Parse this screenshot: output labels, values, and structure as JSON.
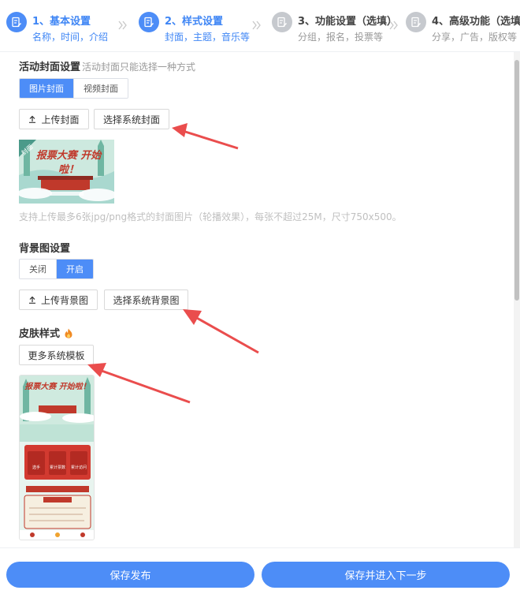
{
  "steps": [
    {
      "title": "1、基本设置",
      "sub": "名称，时间，介绍",
      "state": "active",
      "icon": "edit-doc-icon"
    },
    {
      "title": "2、样式设置",
      "sub": "封面，主题，音乐等",
      "state": "active",
      "icon": "edit-doc-icon"
    },
    {
      "title": "3、功能设置（选填）",
      "sub": "分组，报名，投票等",
      "state": "inactive",
      "icon": "edit-doc-icon"
    },
    {
      "title": "4、高级功能（选填）",
      "sub": "分享，广告，版权等",
      "state": "inactive",
      "icon": "edit-doc-icon"
    }
  ],
  "cover": {
    "title": "活动封面设置",
    "hint": "活动封面只能选择一种方式",
    "tabs": [
      "图片封面",
      "视频封面"
    ],
    "selected_tab": "图片封面",
    "upload_label": "上传封面",
    "choose_label": "选择系统封面",
    "thumb_badge": "封面",
    "thumb_text": "报票大赛 开始啦！",
    "tip": "支持上传最多6张jpg/png格式的封面图片（轮播效果），每张不超过25M，尺寸750x500。"
  },
  "background": {
    "title": "背景图设置",
    "options": [
      "关闭",
      "开启"
    ],
    "selected": "开启",
    "upload_label": "上传背景图",
    "choose_label": "选择系统背景图"
  },
  "skin": {
    "title": "皮肤样式",
    "more_label": "更多系统模板",
    "preview_title": "报票大赛 开始啦！",
    "preview_stats": [
      "选手",
      "累计票数",
      "累计访问"
    ]
  },
  "footer": {
    "publish_label": "保存发布",
    "next_label": "保存并进入下一步"
  },
  "colors": {
    "accent": "#4d8df7",
    "arrow": "#ea4d4d",
    "inactive_step": "#c6c9ce"
  }
}
